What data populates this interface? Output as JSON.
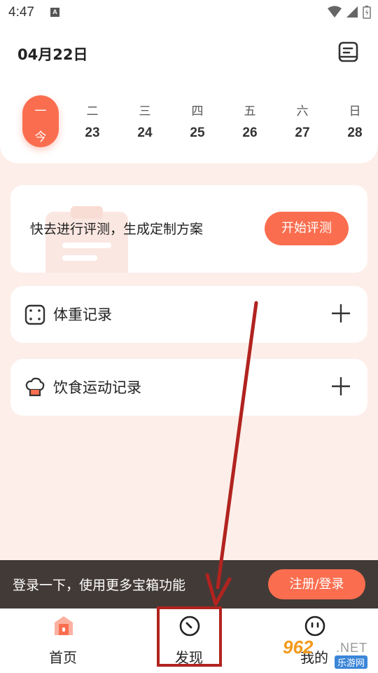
{
  "status_bar": {
    "time": "4:47",
    "notification_badge": "A"
  },
  "header": {
    "date": "04月22日",
    "diary_icon": "journal-icon"
  },
  "week": {
    "days": [
      {
        "weekday": "一",
        "label": "今",
        "today": true
      },
      {
        "weekday": "二",
        "label": "23"
      },
      {
        "weekday": "三",
        "label": "24"
      },
      {
        "weekday": "四",
        "label": "25"
      },
      {
        "weekday": "五",
        "label": "26"
      },
      {
        "weekday": "六",
        "label": "27"
      },
      {
        "weekday": "日",
        "label": "28"
      }
    ]
  },
  "assessment": {
    "text": "快去进行评测，生成定制方案",
    "button": "开始评测"
  },
  "weight_record": {
    "label": "体重记录",
    "icon": "scale-icon"
  },
  "diet_record": {
    "label": "饮食运动记录",
    "icon": "chef-hat-icon"
  },
  "login_banner": {
    "message": "登录一下，使用更多宝箱功能",
    "button": "注册/登录"
  },
  "tabbar": {
    "tabs": [
      {
        "label": "首页",
        "icon": "home-icon"
      },
      {
        "label": "发现",
        "icon": "compass-icon"
      },
      {
        "label": "我的",
        "icon": "face-icon"
      }
    ]
  },
  "watermark": {
    "number": "962",
    "domain": ".NET",
    "site": "乐游网"
  },
  "colors": {
    "accent": "#fa6e4f",
    "background": "#fdeee9",
    "annotation": "#b1231f",
    "banner": "#2d2624"
  }
}
